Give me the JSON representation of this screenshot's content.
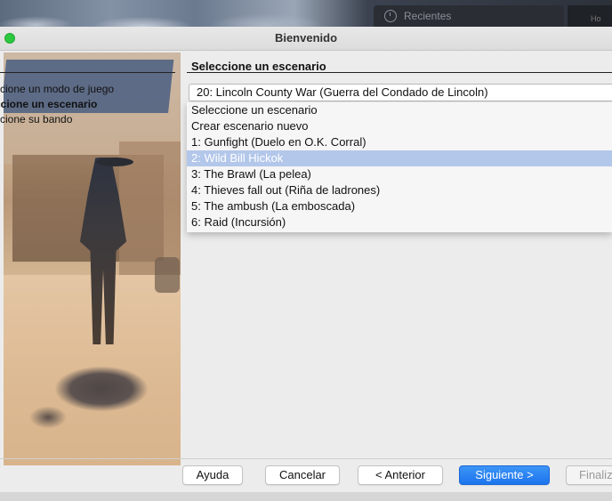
{
  "desktop": {
    "recent_tab_label": "Recientes",
    "corner_text": "Ho"
  },
  "window": {
    "title": "Bienvenido"
  },
  "steps": [
    "ccione un modo de juego",
    "ccione un escenario",
    "ccione su bando"
  ],
  "panel": {
    "heading": "Seleccione un escenario",
    "combo_value": "20: Lincoln County War (Guerra del Condado de Lincoln)",
    "options": [
      "Seleccione un escenario",
      "Crear escenario nuevo",
      "1: Gunfight (Duelo en O.K. Corral)",
      "2: Wild Bill Hickok",
      "3: The Brawl (La pelea)",
      "4: Thieves fall out (Riña de ladrones)",
      "5: The ambush (La emboscada)",
      "6: Raid (Incursión)"
    ],
    "highlighted_option": "2: Wild Bill Hickok"
  },
  "buttons": {
    "help": "Ayuda",
    "cancel": "Cancelar",
    "back": "< Anterior",
    "next": "Siguiente >",
    "finish": "Finaliz"
  },
  "colors": {
    "highlight": "#b3c7ea",
    "primary_button": "#1c74ee",
    "close_dot": "#2bc840"
  }
}
